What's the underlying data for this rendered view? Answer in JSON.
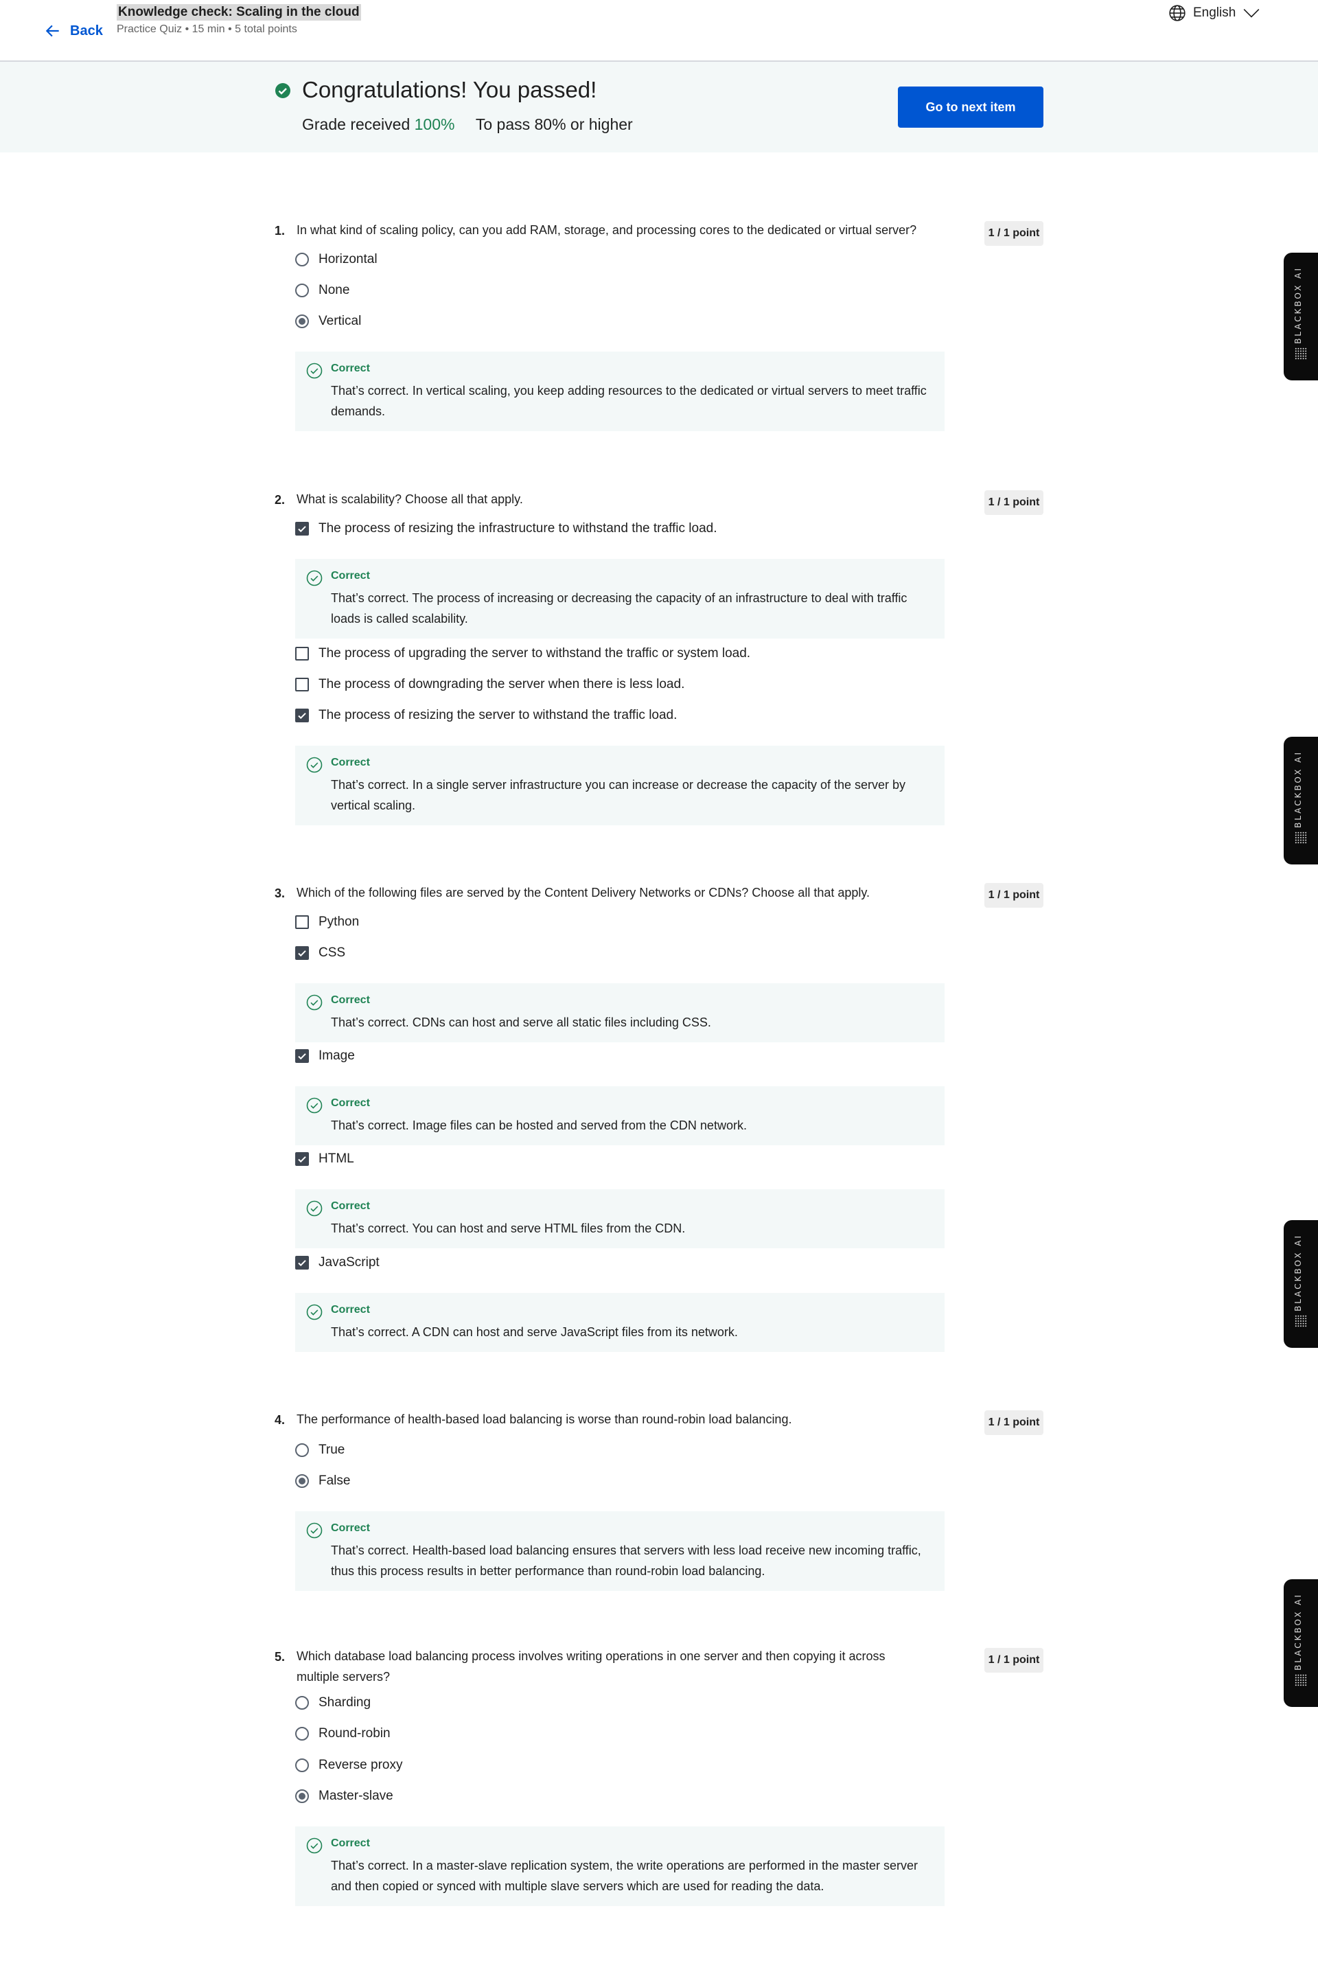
{
  "header": {
    "back_label": "Back",
    "quiz_title": "Knowledge check: Scaling in the cloud",
    "quiz_meta": "Practice Quiz • 15 min • 5 total points",
    "language": "English"
  },
  "banner": {
    "title": "Congratulations! You passed!",
    "grade_label": "Grade received",
    "grade_value": "100%",
    "pass_label": "To pass",
    "pass_value": "80% or higher",
    "next_button": "Go to next item"
  },
  "feedback_label": "Correct",
  "side_tab_label": "BLACKBOX AI",
  "questions": [
    {
      "number": "1.",
      "text": "In what kind of scaling policy, can you add RAM, storage, and processing cores to the dedicated or virtual server?",
      "points": "1 / 1 point",
      "type": "radio",
      "options": [
        "Horizontal",
        "None",
        "Vertical"
      ],
      "selected": [
        false,
        false,
        true
      ],
      "feedback": [
        "That’s correct. In vertical scaling, you keep adding resources to the dedicated or virtual servers to meet traffic demands."
      ]
    },
    {
      "number": "2.",
      "text": "What is scalability? Choose all that apply.",
      "points": "1 / 1 point",
      "type": "checkbox",
      "options": [
        "The process of resizing the infrastructure to withstand the traffic load.",
        "The process of upgrading the server to withstand the traffic or system load.",
        "The process of downgrading the server when there is less load.",
        "The process of resizing the server to withstand the traffic load."
      ],
      "selected": [
        true,
        false,
        false,
        true
      ],
      "feedback": [
        "That’s correct. The process of increasing or decreasing the capacity of an infrastructure to deal with traffic loads is called scalability.",
        "That’s correct. In a single server infrastructure you can increase or decrease the capacity of the server by vertical scaling."
      ]
    },
    {
      "number": "3.",
      "text": "Which of the following files are served by the Content Delivery Networks or CDNs? Choose all that apply.",
      "points": "1 / 1 point",
      "type": "checkbox",
      "options": [
        "Python",
        "CSS",
        "Image",
        "HTML",
        "JavaScript"
      ],
      "selected": [
        false,
        true,
        true,
        true,
        true
      ],
      "feedback": [
        "That’s correct. CDNs can host and serve all static files including CSS.",
        "That’s correct. Image files can be hosted and served from the CDN network.",
        "That’s correct. You can host and serve HTML files from the CDN.",
        "That’s correct. A CDN can host and serve JavaScript files from its network."
      ]
    },
    {
      "number": "4.",
      "text": "The performance of health-based load balancing is worse than round-robin load balancing.",
      "points": "1 / 1 point",
      "type": "radio",
      "options": [
        "True",
        "False"
      ],
      "selected": [
        false,
        true
      ],
      "feedback": [
        "That’s correct.  Health-based load balancing ensures that servers with less load receive new incoming traffic, thus this process results in better performance than round-robin load balancing."
      ]
    },
    {
      "number": "5.",
      "text": "Which database load balancing process involves writing operations in one server and then copying it across multiple servers?",
      "points": "1 / 1 point",
      "type": "radio",
      "options": [
        "Sharding",
        "Round-robin",
        "Reverse proxy",
        "Master-slave"
      ],
      "selected": [
        false,
        false,
        false,
        true
      ],
      "feedback": [
        "That’s correct. In a master-slave replication system, the write operations are performed in the master server and then copied or synced with multiple slave servers which are used for reading the data."
      ]
    }
  ]
}
